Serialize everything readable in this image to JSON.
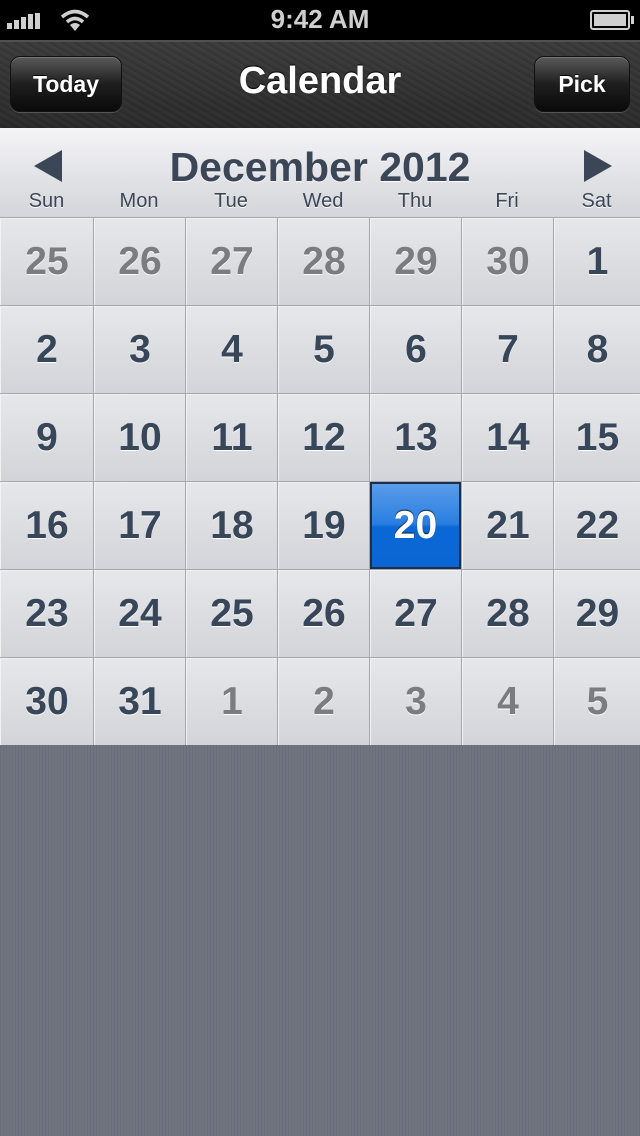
{
  "status_bar": {
    "time": "9:42 AM",
    "signal_icon": "cellular-signal-icon",
    "wifi_icon": "wifi-icon",
    "battery_icon": "battery-icon"
  },
  "navbar": {
    "title": "Calendar",
    "left_button": "Today",
    "right_button": "Pick"
  },
  "calendar": {
    "month_label": "December 2012",
    "prev_icon": "triangle-left-icon",
    "next_icon": "triangle-right-icon",
    "weekdays": [
      "Sun",
      "Mon",
      "Tue",
      "Wed",
      "Thu",
      "Fri",
      "Sat"
    ],
    "selected_day": "20",
    "weeks": [
      [
        {
          "d": "25",
          "cur": false
        },
        {
          "d": "26",
          "cur": false
        },
        {
          "d": "27",
          "cur": false
        },
        {
          "d": "28",
          "cur": false
        },
        {
          "d": "29",
          "cur": false
        },
        {
          "d": "30",
          "cur": false
        },
        {
          "d": "1",
          "cur": true
        }
      ],
      [
        {
          "d": "2",
          "cur": true
        },
        {
          "d": "3",
          "cur": true
        },
        {
          "d": "4",
          "cur": true
        },
        {
          "d": "5",
          "cur": true
        },
        {
          "d": "6",
          "cur": true
        },
        {
          "d": "7",
          "cur": true
        },
        {
          "d": "8",
          "cur": true
        }
      ],
      [
        {
          "d": "9",
          "cur": true
        },
        {
          "d": "10",
          "cur": true
        },
        {
          "d": "11",
          "cur": true
        },
        {
          "d": "12",
          "cur": true
        },
        {
          "d": "13",
          "cur": true
        },
        {
          "d": "14",
          "cur": true
        },
        {
          "d": "15",
          "cur": true
        }
      ],
      [
        {
          "d": "16",
          "cur": true
        },
        {
          "d": "17",
          "cur": true
        },
        {
          "d": "18",
          "cur": true
        },
        {
          "d": "19",
          "cur": true
        },
        {
          "d": "20",
          "cur": true,
          "selected": true
        },
        {
          "d": "21",
          "cur": true
        },
        {
          "d": "22",
          "cur": true
        }
      ],
      [
        {
          "d": "23",
          "cur": true
        },
        {
          "d": "24",
          "cur": true
        },
        {
          "d": "25",
          "cur": true
        },
        {
          "d": "26",
          "cur": true
        },
        {
          "d": "27",
          "cur": true
        },
        {
          "d": "28",
          "cur": true
        },
        {
          "d": "29",
          "cur": true
        }
      ],
      [
        {
          "d": "30",
          "cur": true
        },
        {
          "d": "31",
          "cur": true
        },
        {
          "d": "1",
          "cur": false
        },
        {
          "d": "2",
          "cur": false
        },
        {
          "d": "3",
          "cur": false
        },
        {
          "d": "4",
          "cur": false
        },
        {
          "d": "5",
          "cur": false
        }
      ]
    ]
  },
  "colors": {
    "selected": "#0a68d6",
    "day_text": "#384659",
    "other_month_text": "#7a7c80"
  }
}
